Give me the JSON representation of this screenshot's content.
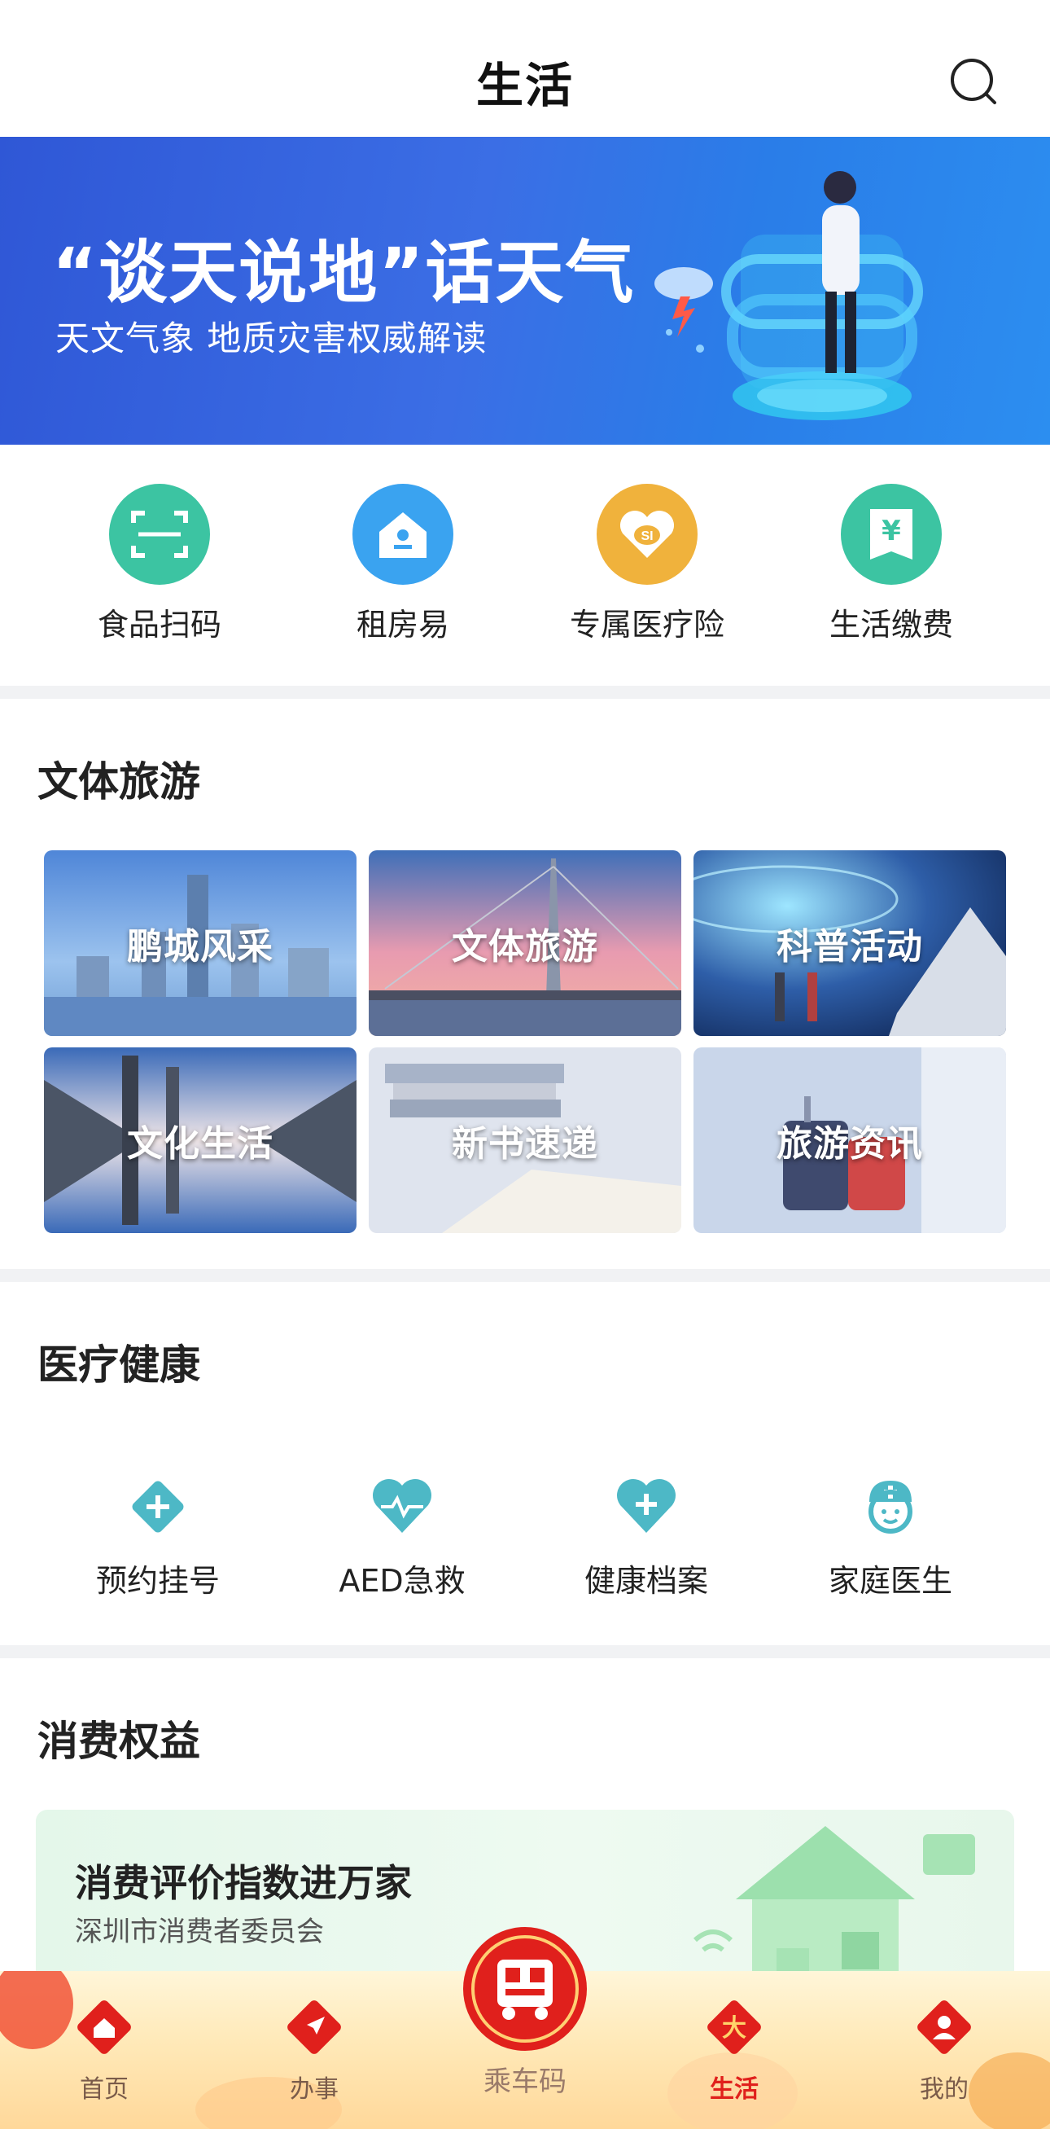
{
  "header": {
    "title": "生活",
    "search_icon": "search-icon"
  },
  "banner": {
    "title": "“谈天说地”话天气",
    "subtitle": "天文气象 地质灾害权威解读"
  },
  "quick_services": [
    {
      "label": "食品扫码",
      "icon": "scan-frame-icon",
      "color": "#3cc4a2"
    },
    {
      "label": "租房易",
      "icon": "house-icon",
      "color": "#3aa3f0"
    },
    {
      "label": "专属医疗险",
      "icon": "heart-shield-icon",
      "color": "#f0b23c"
    },
    {
      "label": "生活缴费",
      "icon": "yen-bill-icon",
      "color": "#3cc4a2"
    }
  ],
  "culture": {
    "title": "文体旅游",
    "tiles": [
      {
        "label": "鹏城风采"
      },
      {
        "label": "文体旅游"
      },
      {
        "label": "科普活动"
      },
      {
        "label": "文化生活"
      },
      {
        "label": "新书速递"
      },
      {
        "label": "旅游资讯"
      }
    ]
  },
  "health": {
    "title": "医疗健康",
    "items": [
      {
        "label": "预约挂号",
        "icon": "plus-diamond-icon"
      },
      {
        "label": "AED急救",
        "icon": "heartbeat-icon"
      },
      {
        "label": "健康档案",
        "icon": "heart-plus-icon"
      },
      {
        "label": "家庭医生",
        "icon": "doctor-icon"
      }
    ],
    "icon_color": "#4db8c6"
  },
  "consumer": {
    "title": "消费权益",
    "card_title": "消费评价指数进万家",
    "card_subtitle": "深圳市消费者委员会"
  },
  "tabbar": {
    "items": [
      {
        "label": "首页",
        "icon": "home-icon"
      },
      {
        "label": "办事",
        "icon": "navigation-arrow-icon"
      },
      {
        "label": "乘车码",
        "icon": "bus-qr-icon"
      },
      {
        "label": "生活",
        "icon": "life-icon",
        "active": true,
        "glyph": "大"
      },
      {
        "label": "我的",
        "icon": "user-icon"
      }
    ],
    "active_color": "#e0201c"
  }
}
